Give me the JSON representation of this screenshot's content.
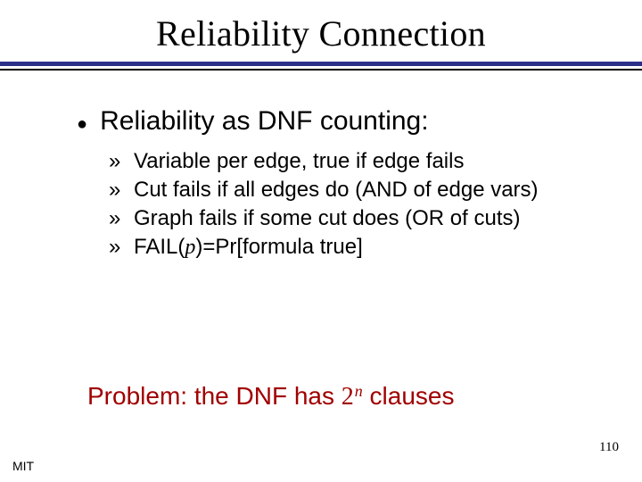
{
  "title": "Reliability Connection",
  "l1": {
    "bullet": "●",
    "text": "Reliability as DNF counting:"
  },
  "sub": [
    {
      "raquo": "»",
      "text": "Variable per edge, true if edge fails"
    },
    {
      "raquo": "»",
      "text": "Cut fails if all edges do (AND of edge vars)"
    },
    {
      "raquo": "»",
      "text": "Graph fails if some cut does (OR of cuts)"
    },
    {
      "raquo": "»",
      "pre": "FAIL(",
      "ital": "p",
      "post": ")=Pr[formula true]"
    }
  ],
  "problem": {
    "pre": "Problem: the DNF has ",
    "base": "2",
    "exp": "n",
    "post": " clauses"
  },
  "pagenum": "110",
  "mit": "MIT"
}
